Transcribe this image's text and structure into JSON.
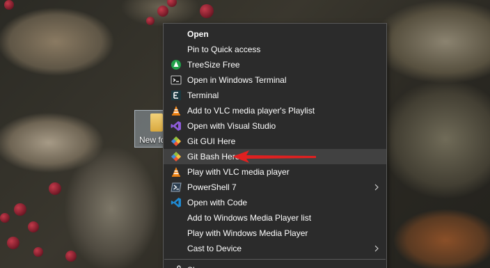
{
  "desktop": {
    "folder_label": "New fo"
  },
  "context_menu": {
    "items": [
      {
        "label": "Open",
        "icon": "none",
        "bold": true
      },
      {
        "label": "Pin to Quick access",
        "icon": "none"
      },
      {
        "label": "TreeSize Free",
        "icon": "treesize-icon"
      },
      {
        "label": "Open in Windows Terminal",
        "icon": "windows-terminal-icon"
      },
      {
        "label": "Terminal",
        "icon": "terminal-icon"
      },
      {
        "label": "Add to VLC media player's Playlist",
        "icon": "vlc-icon"
      },
      {
        "label": "Open with Visual Studio",
        "icon": "visual-studio-icon"
      },
      {
        "label": "Git GUI Here",
        "icon": "git-icon"
      },
      {
        "label": "Git Bash Here",
        "icon": "git-icon",
        "highlighted": true
      },
      {
        "label": "Play with VLC media player",
        "icon": "vlc-icon"
      },
      {
        "label": "PowerShell 7",
        "icon": "powershell-icon",
        "submenu": true
      },
      {
        "label": "Open with Code",
        "icon": "vscode-icon"
      },
      {
        "label": "Add to Windows Media Player list",
        "icon": "none"
      },
      {
        "label": "Play with Windows Media Player",
        "icon": "none"
      },
      {
        "label": "Cast to Device",
        "icon": "none",
        "submenu": true
      },
      {
        "label": "Sh",
        "icon": "share-icon"
      }
    ]
  },
  "colors": {
    "menu_bg": "#2b2b2b",
    "menu_highlight": "#414141",
    "annotation_arrow": "#e02020"
  }
}
